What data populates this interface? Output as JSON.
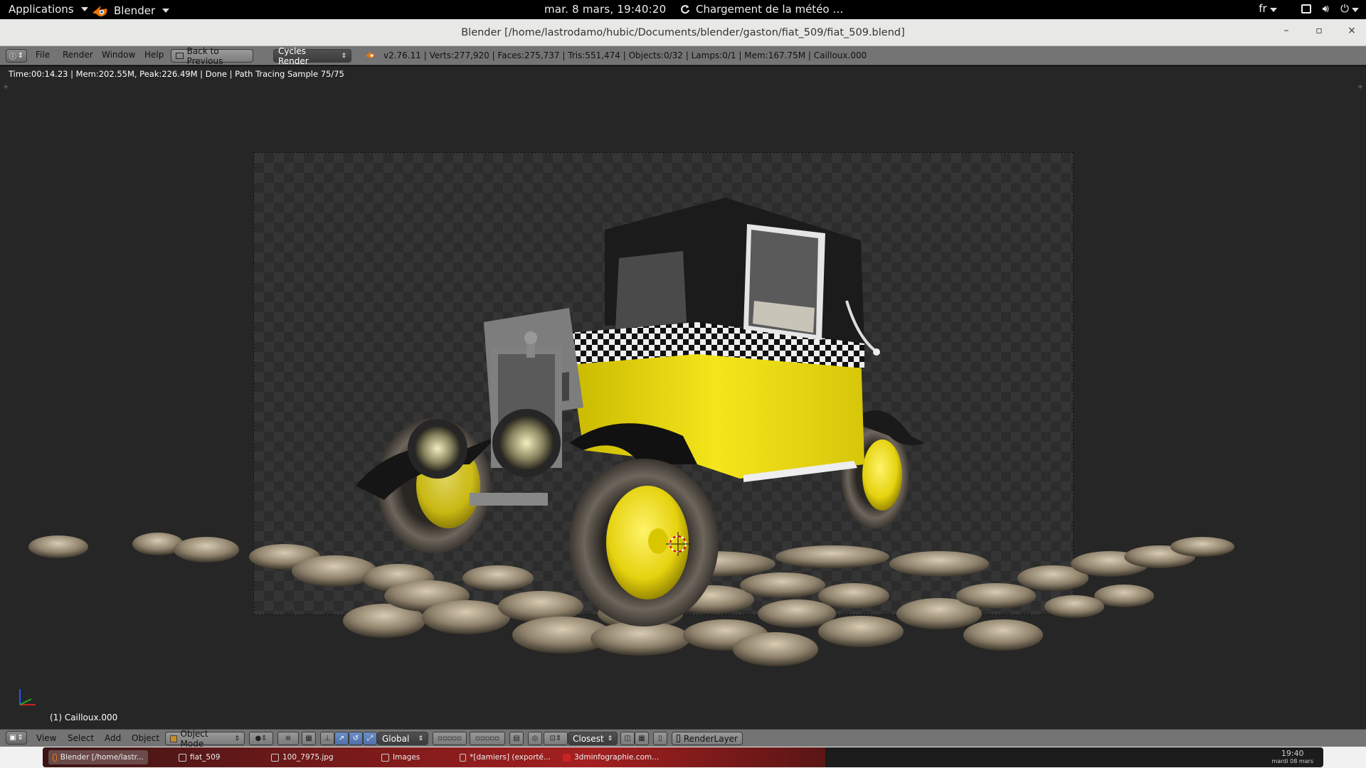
{
  "topbar": {
    "applications": "Applications",
    "app_name": "Blender",
    "clock": "mar.  8 mars, 19:40:20",
    "weather": "Chargement de la météo …",
    "lang": "fr"
  },
  "window": {
    "title": "Blender [/home/lastrodamo/hubic/Documents/blender/gaston/fiat_509/fiat_509.blend]",
    "minimize": "–",
    "maximize": "▫",
    "close": "×"
  },
  "info_header": {
    "menus": [
      "File",
      "Render",
      "Window",
      "Help"
    ],
    "back_button": "Back to Previous",
    "render_engine": "Cycles Render",
    "stats": "v2.76.11 | Verts:277,920 | Faces:275,737 | Tris:551,474 | Objects:0/32 | Lamps:0/1 | Mem:167.75M | Cailloux.000"
  },
  "viewport": {
    "render_status": "Time:00:14.23 | Mem:202.55M, Peak:226.49M | Done | Path Tracing Sample 75/75",
    "object_label": "(1) Cailloux.000"
  },
  "view3d_header": {
    "menus": [
      "View",
      "Select",
      "Add",
      "Object"
    ],
    "mode": "Object Mode",
    "orientation": "Global",
    "snap_target": "Closest",
    "render_layer": "RenderLayer"
  },
  "taskbar": {
    "tasks": [
      "Blender [/home/lastr...",
      "fiat_509",
      "100_7975.jpg",
      "Images",
      "*[damiers] (exporté...",
      "3dminfographie.com..."
    ],
    "time": "19:40",
    "date": "mardi 08 mars"
  },
  "colors": {
    "car_yellow": "#f2e01a",
    "viewport_bg": "#262626",
    "header_gray": "#747474"
  }
}
